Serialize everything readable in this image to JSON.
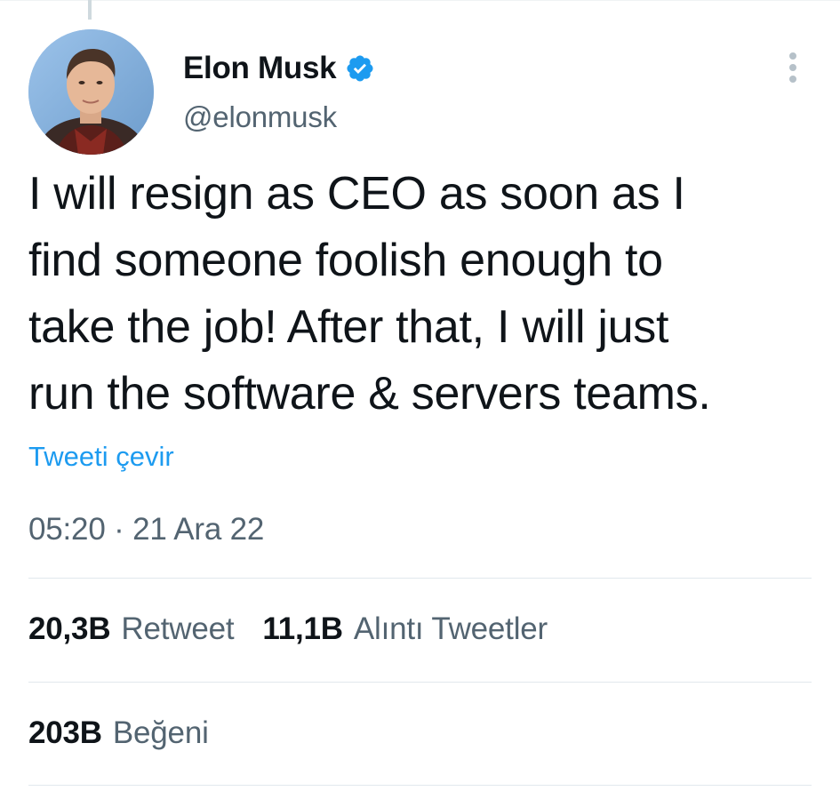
{
  "tweet": {
    "author": {
      "display_name": "Elon Musk",
      "handle": "@elonmusk",
      "verified": true,
      "avatar_icon": "profile-photo"
    },
    "text_lines": [
      "I will resign as CEO as soon as I",
      "find someone foolish enough to",
      "take the job! After that, I will just",
      "run the software & servers teams."
    ],
    "translate_label": "Tweeti çevir",
    "timestamp": "05:20 · 21 Ara 22",
    "stats": {
      "retweets": {
        "count": "20,3B",
        "label": "Retweet"
      },
      "quotes": {
        "count": "11,1B",
        "label": "Alıntı Tweetler"
      },
      "likes": {
        "count": "203B",
        "label": "Beğeni"
      }
    }
  },
  "colors": {
    "link": "#1d9bf0",
    "text": "#0f1419",
    "secondary": "#536471",
    "divider": "#e1e8ed"
  },
  "icons": {
    "verified": "verified-badge-icon",
    "more": "more-vertical-icon"
  }
}
